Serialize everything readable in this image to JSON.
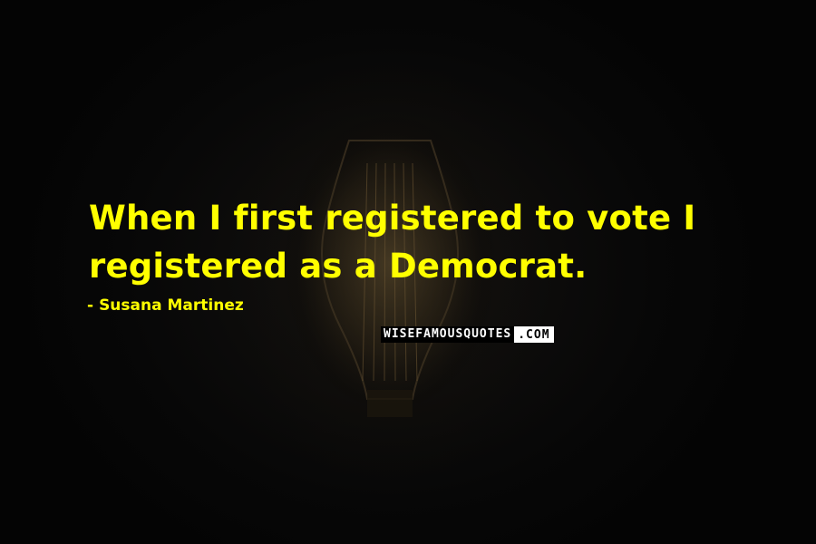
{
  "quote": {
    "line1": "When I first registered to vote I",
    "line2": "registered as a Democrat."
  },
  "author": {
    "dash": "-",
    "name": "Susana Martinez"
  },
  "watermark": {
    "main": "WISEFAMOUSQUOTES",
    "suffix": ".COM"
  },
  "colors": {
    "text": "#ffff00",
    "background": "#050505"
  },
  "background_image": "edison-light-bulb-in-dark"
}
